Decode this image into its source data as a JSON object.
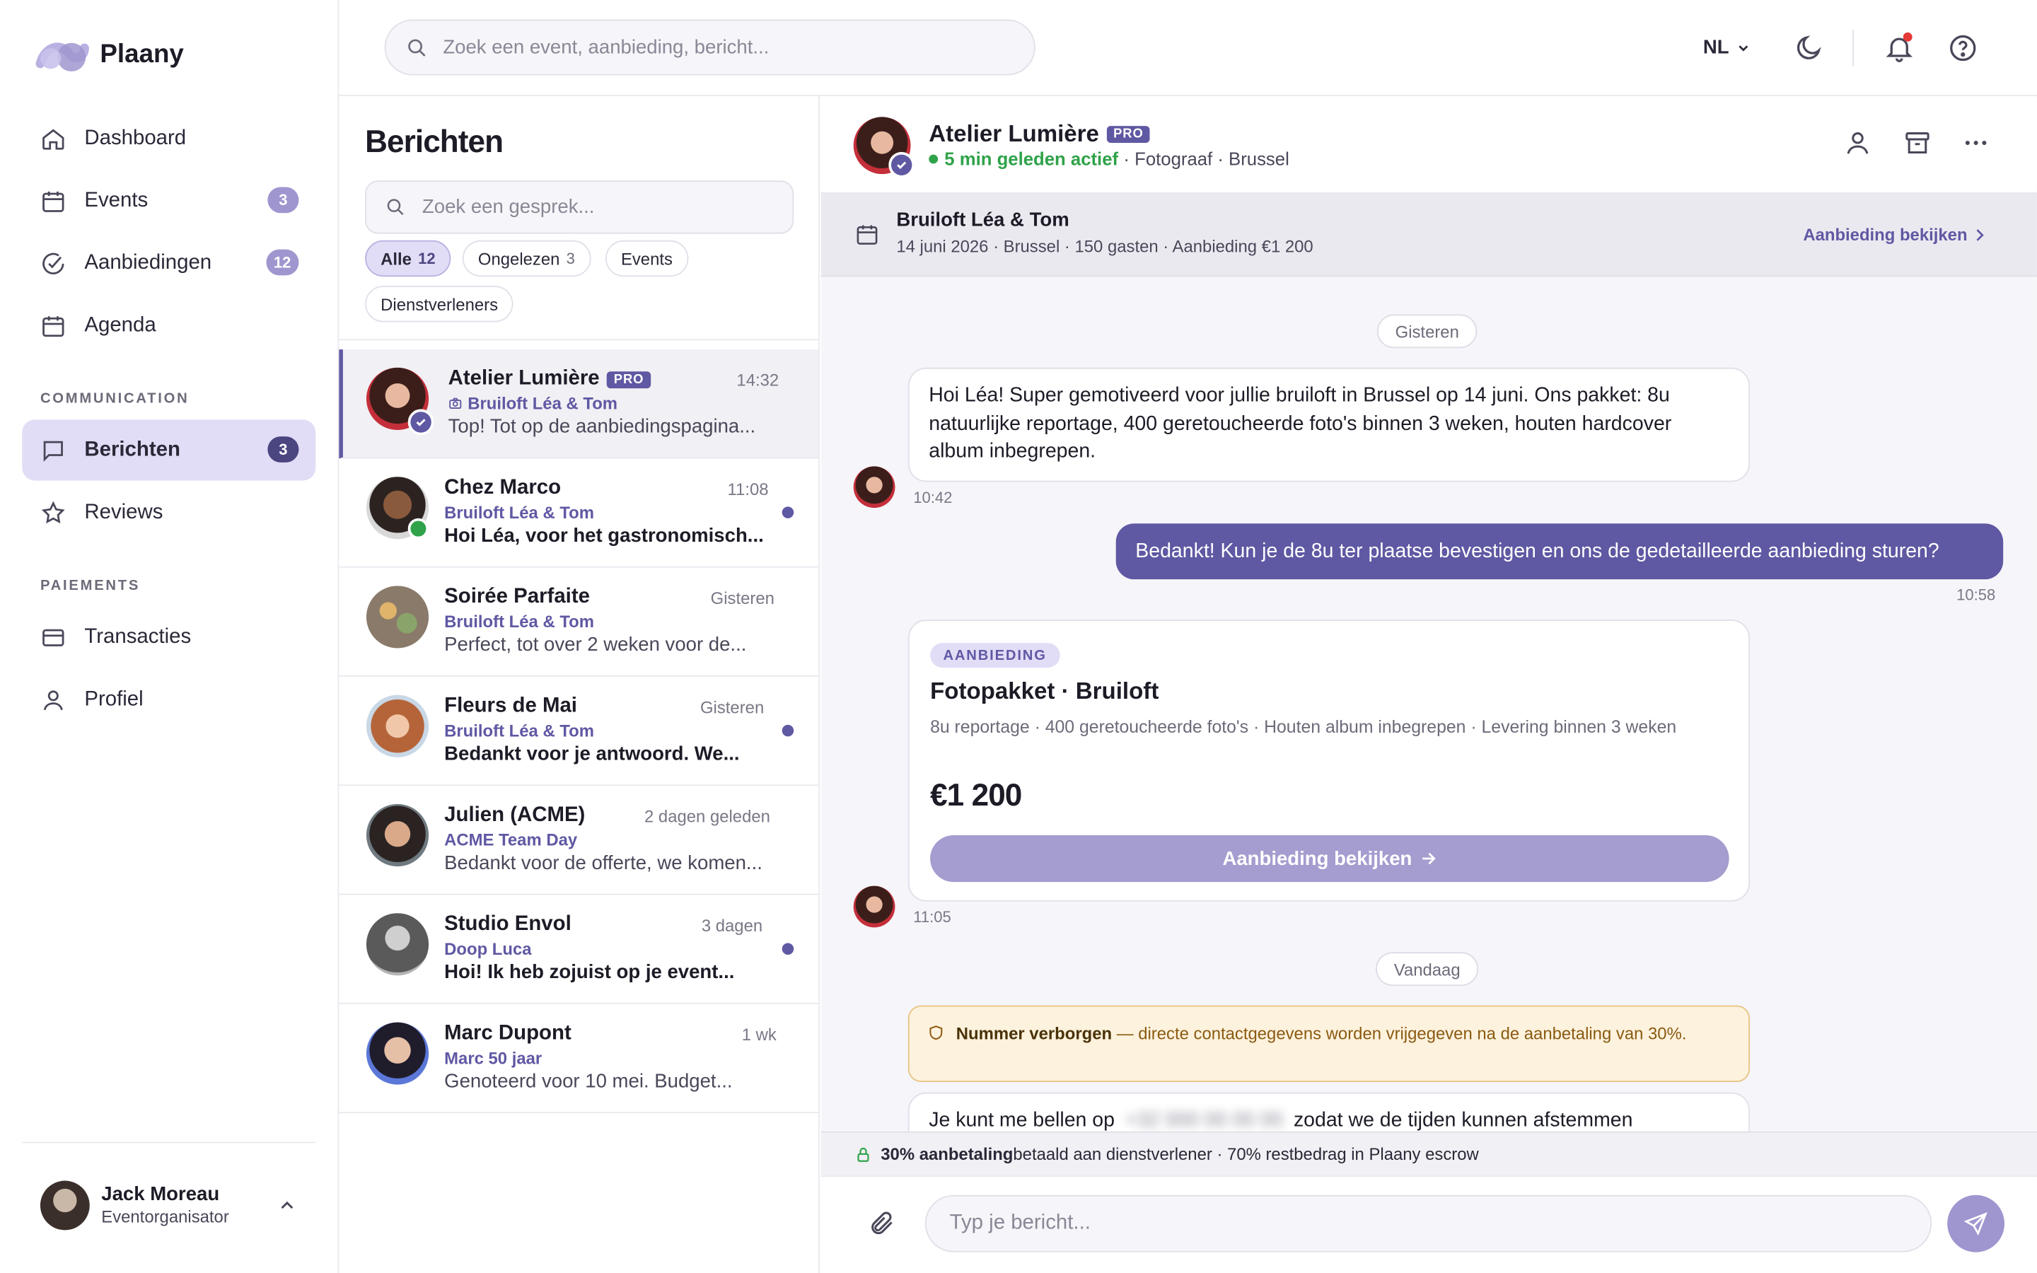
{
  "app": {
    "name": "Plaany"
  },
  "search": {
    "placeholder": "Zoek een event, aanbieding, bericht..."
  },
  "topbar": {
    "language": "NL"
  },
  "sidebar": {
    "items": [
      {
        "label": "Dashboard",
        "icon": "home-icon"
      },
      {
        "label": "Events",
        "icon": "calendar-icon",
        "badge": "3"
      },
      {
        "label": "Aanbiedingen",
        "icon": "check-circle-icon",
        "badge": "12"
      },
      {
        "label": "Agenda",
        "icon": "calendar-icon"
      }
    ],
    "section_communication": "COMMUNICATION",
    "communication_items": [
      {
        "label": "Berichten",
        "icon": "message-icon",
        "badge": "3",
        "active": true
      },
      {
        "label": "Reviews",
        "icon": "star-icon"
      }
    ],
    "section_payments": "PAIEMENTS",
    "payment_items": [
      {
        "label": "Transacties",
        "icon": "card-icon"
      },
      {
        "label": "Profiel",
        "icon": "user-icon"
      }
    ],
    "user": {
      "name": "Jack Moreau",
      "role": "Eventorganisator"
    }
  },
  "messages_list": {
    "title": "Berichten",
    "search_placeholder": "Zoek een gesprek...",
    "filters": [
      {
        "label": "Alle",
        "count": "12",
        "active": true
      },
      {
        "label": "Ongelezen",
        "count": "3"
      },
      {
        "label": "Events"
      },
      {
        "label": "Dienstverleners"
      }
    ],
    "conversations": [
      {
        "name": "Atelier Lumière",
        "pro": "PRO",
        "time": "14:32",
        "event": "Bruiloft Léa & Tom",
        "preview": "Top! Tot op de aanbiedingspagina...",
        "active": true
      },
      {
        "name": "Chez Marco",
        "time": "11:08",
        "event": "Bruiloft Léa & Tom",
        "preview": "Hoi Léa, voor het gastronomisch...",
        "unread": true,
        "online": true
      },
      {
        "name": "Soirée Parfaite",
        "time": "Gisteren",
        "event": "Bruiloft Léa & Tom",
        "preview": "Perfect, tot over 2 weken voor de..."
      },
      {
        "name": "Fleurs de Mai",
        "time": "Gisteren",
        "event": "Bruiloft Léa & Tom",
        "preview": "Bedankt voor je antwoord. We...",
        "unread": true
      },
      {
        "name": "Julien (ACME)",
        "time": "2 dagen geleden",
        "event": "ACME Team Day",
        "preview": "Bedankt voor de offerte, we komen..."
      },
      {
        "name": "Studio Envol",
        "time": "3 dagen",
        "event": "Doop Luca",
        "preview": "Hoi! Ik heb zojuist op je event...",
        "unread": true
      },
      {
        "name": "Marc Dupont",
        "time": "1 wk",
        "event": "Marc 50 jaar",
        "preview": "Genoteerd voor 10 mei. Budget..."
      }
    ]
  },
  "chat": {
    "contact": {
      "name": "Atelier Lumière",
      "pro": "PRO",
      "status": "5 min geleden actief",
      "details": "· Fotograaf · Brussel"
    },
    "offer_bar": {
      "title": "Bruiloft Léa & Tom",
      "details": "14 juni 2026 · Brussel · 150 gasten · Aanbieding €1 200",
      "link": "Aanbieding bekijken"
    },
    "day1": "Gisteren",
    "msg1": {
      "text": "Hoi Léa! Super gemotiveerd voor jullie bruiloft in Brussel op 14 juni. Ons pakket: 8u natuurlijke reportage, 400 geretoucheerde foto's binnen 3 weken, houten hardcover album inbegrepen.",
      "time": "10:42"
    },
    "msg2": {
      "text": "Bedankt! Kun je de 8u ter plaatse bevestigen en ons de gedetailleerde aanbieding sturen?",
      "time": "10:58"
    },
    "offer": {
      "tag": "AANBIEDING",
      "title": "Fotopakket · Bruiloft",
      "description": "8u reportage · 400 geretoucheerde foto's · Houten album inbegrepen · Levering binnen 3 weken",
      "price": "€1 200",
      "button": "Aanbieding bekijken",
      "time": "11:05"
    },
    "day2": "Vandaag",
    "warning": {
      "bold": "Nummer verborgen",
      "text": " — directe contactgegevens worden vrijgegeven na de aanbetaling van 30%."
    },
    "msg3": {
      "before": "Je kunt me bellen op",
      "hidden": "+32 000 00 00 00",
      "after": "zodat we de tijden kunnen afstemmen"
    },
    "escrow": {
      "bold": "30% aanbetaling",
      "text": " betaald aan dienstverlener · 70% restbedrag in Plaany escrow"
    },
    "composer_placeholder": "Typ je bericht..."
  },
  "colors": {
    "accent": "#5f58a3",
    "accent_light": "#e2ddf6",
    "online": "#2fa24a",
    "notification": "#e53935"
  }
}
